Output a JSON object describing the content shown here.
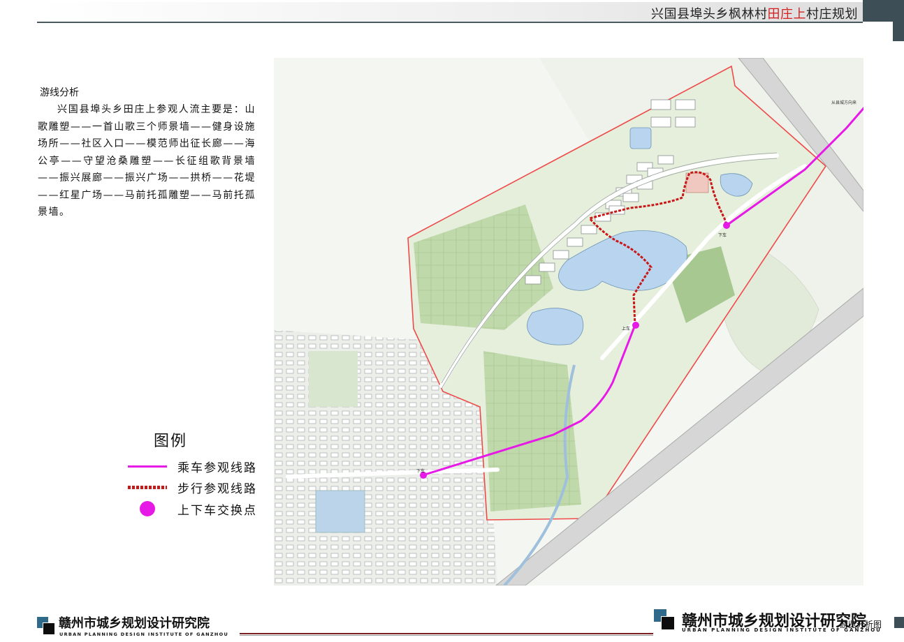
{
  "header": {
    "title_part1": "兴国县埠头乡枫林村",
    "title_highlight": "田庄上",
    "title_part2": "村庄规划"
  },
  "description": {
    "title": "游线分析",
    "body": "兴国县埠头乡田庄上参观人流主要是：山歌雕塑——一首山歌三个师景墙——健身设施场所——社区入口——模范师出征长廊——海公亭——守望沧桑雕塑——长征组歌背景墙——振兴展廊——振兴广场——拱桥——花堤——红星广场——马前托孤雕塑——马前托孤景墙。"
  },
  "map": {
    "labels": {
      "from_county": "从县城方向来",
      "stop_top": "下车",
      "stop_middle": "上车",
      "stop_bottom": "下车"
    },
    "colors": {
      "vehicle_route": "#e619e6",
      "walking_route": "#c81818",
      "boundary": "#ee4a4a",
      "water": "#b8d4ee"
    }
  },
  "legend": {
    "title": "图例",
    "items": [
      {
        "label": "乘车参观线路",
        "symbol": "magenta-line"
      },
      {
        "label": "步行参观线路",
        "symbol": "red-dashed-line"
      },
      {
        "label": "上下车交换点",
        "symbol": "magenta-dot"
      }
    ]
  },
  "footer": {
    "org_cn": "赣州市城乡规划设计研究院",
    "org_en": "URBAN PLANNING DESIGN INSTITUTE OF GANZHOU",
    "page_name": "游览分析图"
  }
}
